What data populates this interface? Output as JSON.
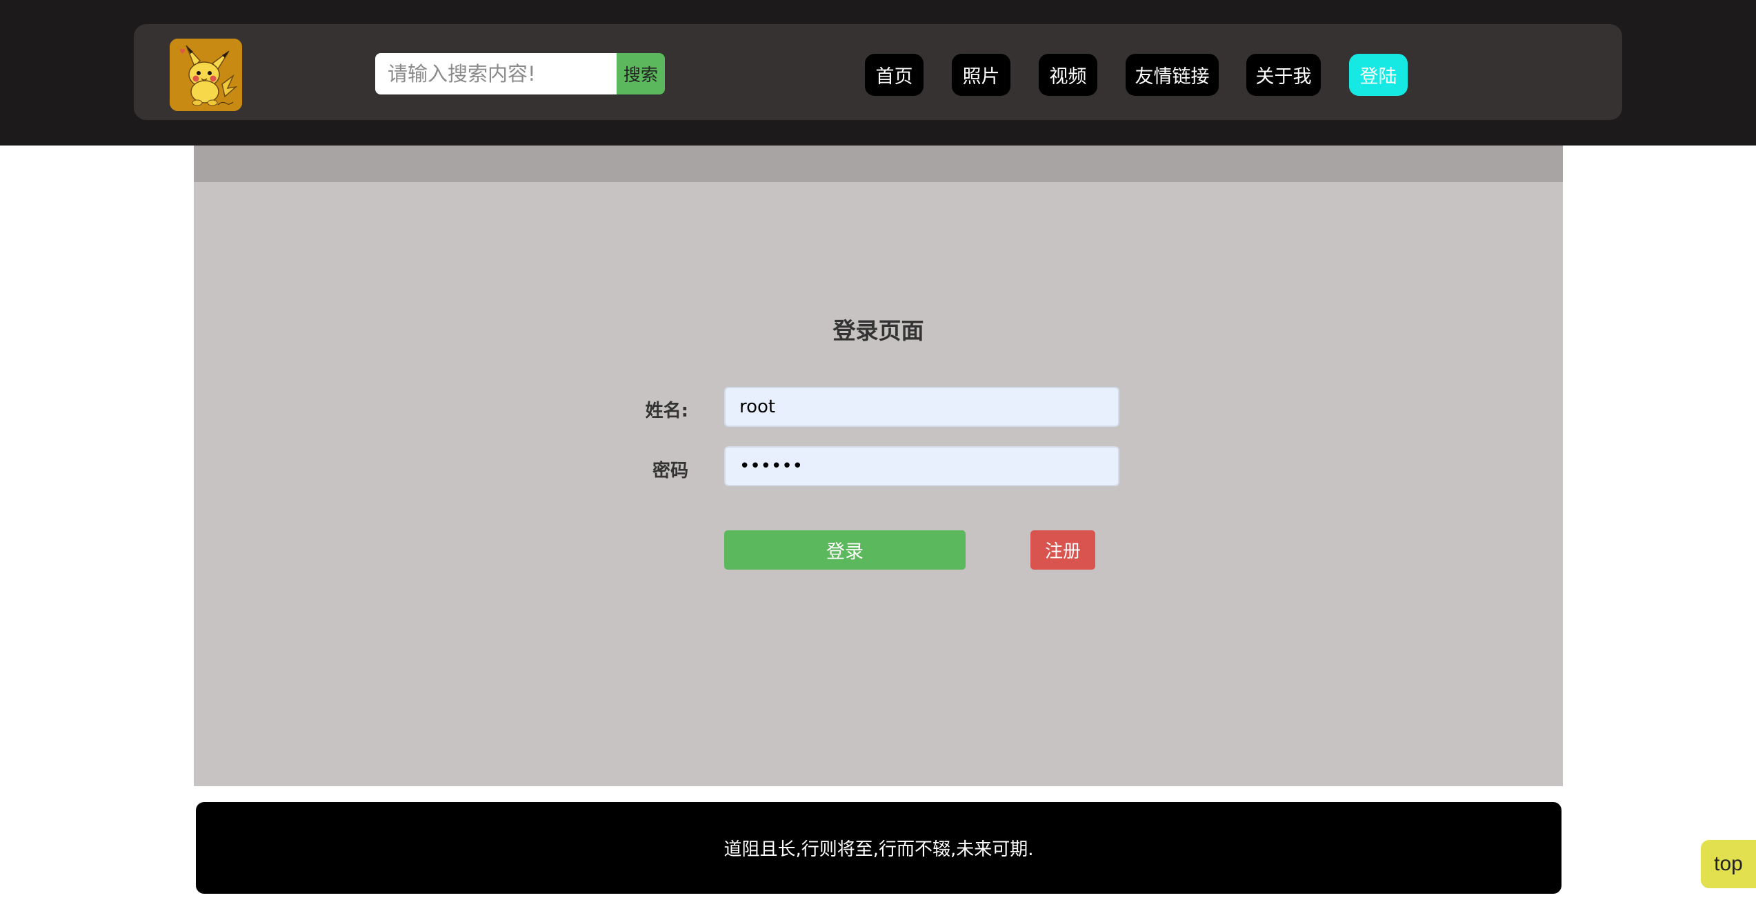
{
  "header": {
    "search": {
      "placeholder": "请输入搜索内容!",
      "button_label": "搜索"
    },
    "nav": [
      {
        "label": "首页",
        "active": false
      },
      {
        "label": "照片",
        "active": false
      },
      {
        "label": "视频",
        "active": false
      },
      {
        "label": "友情链接",
        "active": false
      },
      {
        "label": "关于我",
        "active": false
      },
      {
        "label": "登陆",
        "active": true
      }
    ],
    "logo_icon": "pikachu-logo-icon",
    "colors": {
      "bar": "#1c1a1a",
      "inner": "#363231",
      "nav_active": "#16e8e3",
      "search_button": "#5cb85c"
    }
  },
  "login": {
    "title": "登录页面",
    "username_label": "姓名:",
    "username_value": "root",
    "password_label": "密码",
    "password_value": "••••••",
    "login_button": "登录",
    "register_button": "注册",
    "colors": {
      "panel": "#c7c3c2",
      "login": "#5cb85c",
      "register": "#d9534f"
    }
  },
  "footer": {
    "text": "道阻且长,行则将至,行而不辍,未来可期."
  },
  "back_to_top": {
    "label": "top"
  }
}
